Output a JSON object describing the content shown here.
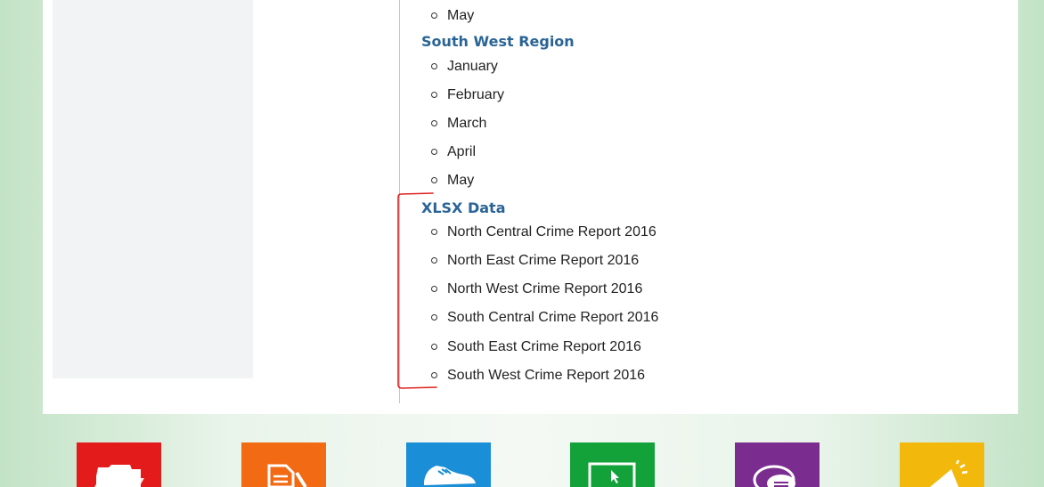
{
  "prev_section": {
    "items": [
      "May"
    ]
  },
  "south_west": {
    "heading": "South West Region",
    "items": [
      "January",
      "February",
      "March",
      "April",
      "May"
    ]
  },
  "xlsx": {
    "heading": "XLSX Data",
    "items": [
      "North Central Crime Report 2016",
      "North East Crime Report 2016",
      "North West Crime Report 2016",
      "South Central Crime Report 2016",
      "South East Crime Report 2016",
      "South West Crime Report 2016"
    ]
  },
  "annotation": {
    "color": "#e02020"
  },
  "tiles": [
    {
      "icon": "folder-icon",
      "color": "#e31b1b"
    },
    {
      "icon": "document-edit-icon",
      "color": "#f26a14"
    },
    {
      "icon": "sneaker-icon",
      "color": "#1a8ed6"
    },
    {
      "icon": "monitor-cursor-icon",
      "color": "#13a23a"
    },
    {
      "icon": "chat-bubble-icon",
      "color": "#7b2d8f"
    },
    {
      "icon": "megaphone-icon",
      "color": "#f2b90c"
    }
  ]
}
